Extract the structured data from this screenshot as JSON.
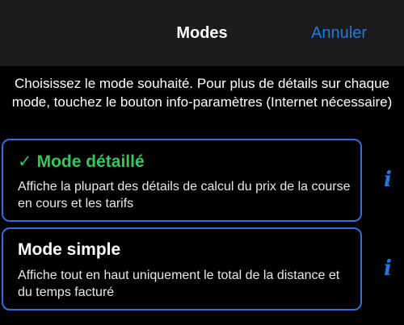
{
  "header": {
    "title": "Modes",
    "cancel_label": "Annuler"
  },
  "intro_text": "Choisissez le mode souhaité. Pour plus de détails sur chaque mode, touchez le bouton info-paramètres (Internet nécessaire)",
  "modes": [
    {
      "check": "✓",
      "title": "Mode détaillé",
      "description": "Affiche la plupart des détails de calcul du prix de la course en cours et les tarifs",
      "info_icon": "i"
    },
    {
      "title": "Mode simple",
      "description": "Affiche tout en haut uniquement le total de la distance et du temps facturé",
      "info_icon": "i"
    }
  ],
  "colors": {
    "accent": "#1f7ae0",
    "selected": "#34c759",
    "card_border": "#2f6fe0",
    "nav_background": "#1c1c1e",
    "background": "#000000"
  }
}
